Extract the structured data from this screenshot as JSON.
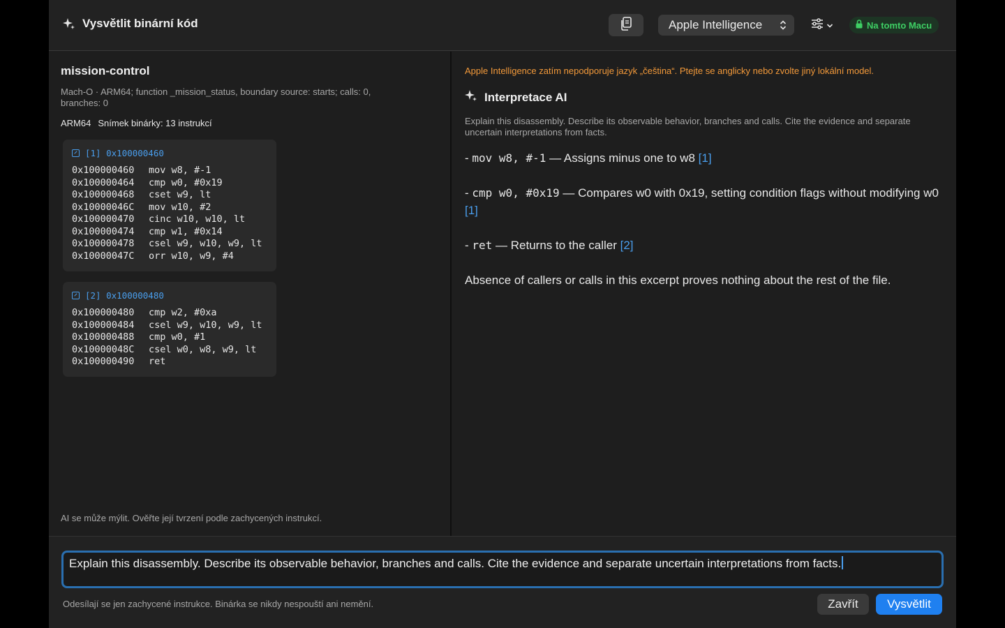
{
  "header": {
    "title": "Vysvětlit binární kód",
    "model_select": "Apple Intelligence",
    "local_badge": "Na tomto Macu",
    "colors": {
      "badge_text": "#3ecf64",
      "badge_bg": "#1d3524"
    }
  },
  "binary": {
    "name": "mission-control",
    "description": "Mach-O · ARM64; function _mission_status, boundary source: starts; calls: 0, branches: 0",
    "arch": "ARM64",
    "snapshot": "Snímek binárky: 13 instrukcí"
  },
  "blocks": [
    {
      "label": "[1] 0x100000460",
      "instructions": [
        {
          "addr": "0x100000460",
          "asm": "mov w8, #-1"
        },
        {
          "addr": "0x100000464",
          "asm": "cmp w0, #0x19"
        },
        {
          "addr": "0x100000468",
          "asm": "cset w9, lt"
        },
        {
          "addr": "0x10000046C",
          "asm": "mov w10, #2"
        },
        {
          "addr": "0x100000470",
          "asm": "cinc w10, w10, lt"
        },
        {
          "addr": "0x100000474",
          "asm": "cmp w1, #0x14"
        },
        {
          "addr": "0x100000478",
          "asm": "csel w9, w10, w9, lt"
        },
        {
          "addr": "0x10000047C",
          "asm": "orr w10, w9, #4"
        }
      ]
    },
    {
      "label": "[2] 0x100000480",
      "instructions": [
        {
          "addr": "0x100000480",
          "asm": "cmp w2, #0xa"
        },
        {
          "addr": "0x100000484",
          "asm": "csel w9, w10, w9, lt"
        },
        {
          "addr": "0x100000488",
          "asm": "cmp w0, #1"
        },
        {
          "addr": "0x10000048C",
          "asm": "csel w0, w8, w9, lt"
        },
        {
          "addr": "0x100000490",
          "asm": "ret"
        }
      ]
    }
  ],
  "left_disclaimer": "AI se může mýlit. Ověřte její tvrzení podle zachycených instrukcí.",
  "ai": {
    "warning": "Apple Intelligence zatím nepodporuje jazyk „čeština“. Ptejte se anglicky nebo zvolte jiný lokální model.",
    "title": "Interpretace AI",
    "prompt_echo": "Explain this disassembly. Describe its observable behavior, branches and calls. Cite the evidence and separate uncertain interpretations from facts.",
    "items": [
      {
        "prefix": "- ",
        "code": "mov w8, #-1",
        "text": " — Assigns minus one to w8 ",
        "cite": "[1]"
      },
      {
        "prefix": "- ",
        "code": "cmp w0, #0x19",
        "text": " — Compares w0 with 0x19, setting condition flags without modifying w0 ",
        "cite": "[1]"
      },
      {
        "prefix": "- ",
        "code": "ret",
        "text": " — Returns to the caller ",
        "cite": "[2]"
      }
    ],
    "conclusion": "Absence of callers or calls in this excerpt proves nothing about the rest of the file."
  },
  "footer": {
    "prompt_value": "Explain this disassembly. Describe its observable behavior, branches and calls. Cite the evidence and separate uncertain interpretations from facts.",
    "note": "Odesílají se jen zachycené instrukce. Binárka se nikdy nespouští ani nemění.",
    "close_label": "Zavřít",
    "explain_label": "Vysvětlit",
    "colors": {
      "primary": "#1f80f0",
      "warning": "#f49a3a",
      "link": "#4a9fee"
    }
  }
}
